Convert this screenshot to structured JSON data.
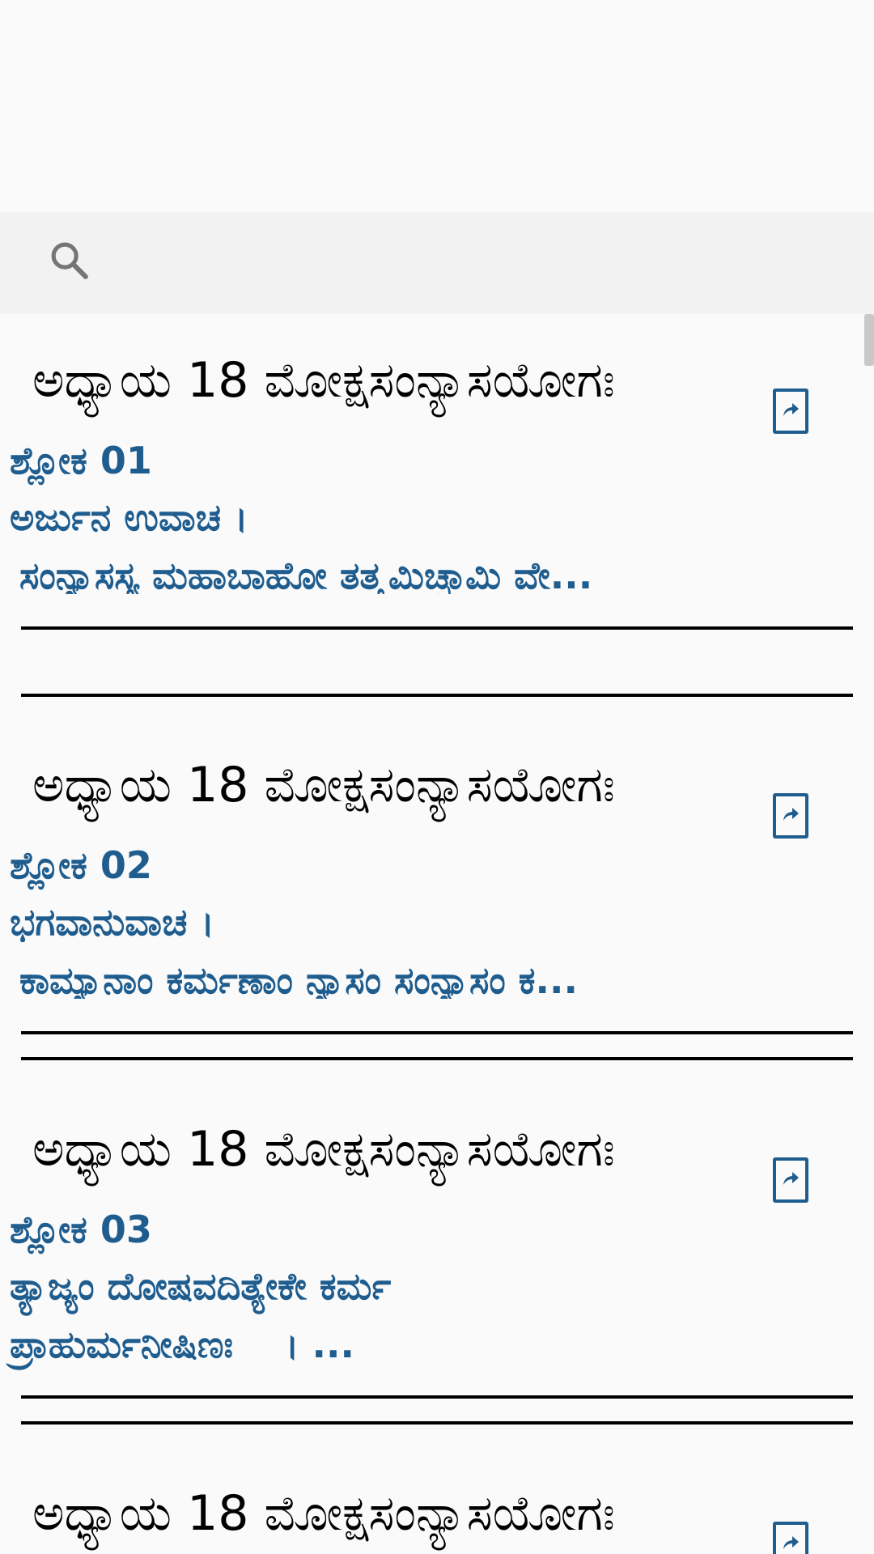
{
  "search": {
    "icon": "search-icon",
    "placeholder": ""
  },
  "items": [
    {
      "title": "ಅಧ್ಯಾಯ 18 ಮೋಕ್ಷಸಂನ್ಯಾಸಯೋಗಃ",
      "verse": "ಶ್ಲೋಕ 01",
      "line1": "ಅರ್ಜುನ ಉವಾಚ ।",
      "line2": "ಸಂನ್ಯಾಸಸ್ಯ ಮಹಾಬಾಹೋ ತತ್ತ್ವಮಿಚ್ಛಾಮಿ ವೇ..."
    },
    {
      "title": "ಅಧ್ಯಾಯ 18 ಮೋಕ್ಷಸಂನ್ಯಾಸಯೋಗಃ",
      "verse": "ಶ್ಲೋಕ 02",
      "line1": "ಭಗವಾನುವಾಚ ।",
      "line2": "ಕಾಮ್ಯಾನಾಂ ಕರ್ಮಣಾಂ ನ್ಯಾಸಂ ಸಂನ್ಯಾಸಂ ಕ..."
    },
    {
      "title": "ಅಧ್ಯಾಯ 18 ಮೋಕ್ಷಸಂನ್ಯಾಸಯೋಗಃ",
      "verse": "ಶ್ಲೋಕ 03",
      "line1": "ತ್ಯಾಜ್ಯಂ ದೋಷವದಿತ್ಯೇಕೇ ಕರ್ಮ",
      "line2": "ಪ್ರಾಹುರ್ಮನೀಷಿಣಃ    । ..."
    },
    {
      "title": "ಅಧ್ಯಾಯ 18 ಮೋಕ್ಷಸಂನ್ಯಾಸಯೋಗಃ"
    }
  ],
  "colors": {
    "accent": "#1f5d8f",
    "title": "#000000",
    "background": "#fafafa",
    "search_bar": "#f2f2f2"
  }
}
